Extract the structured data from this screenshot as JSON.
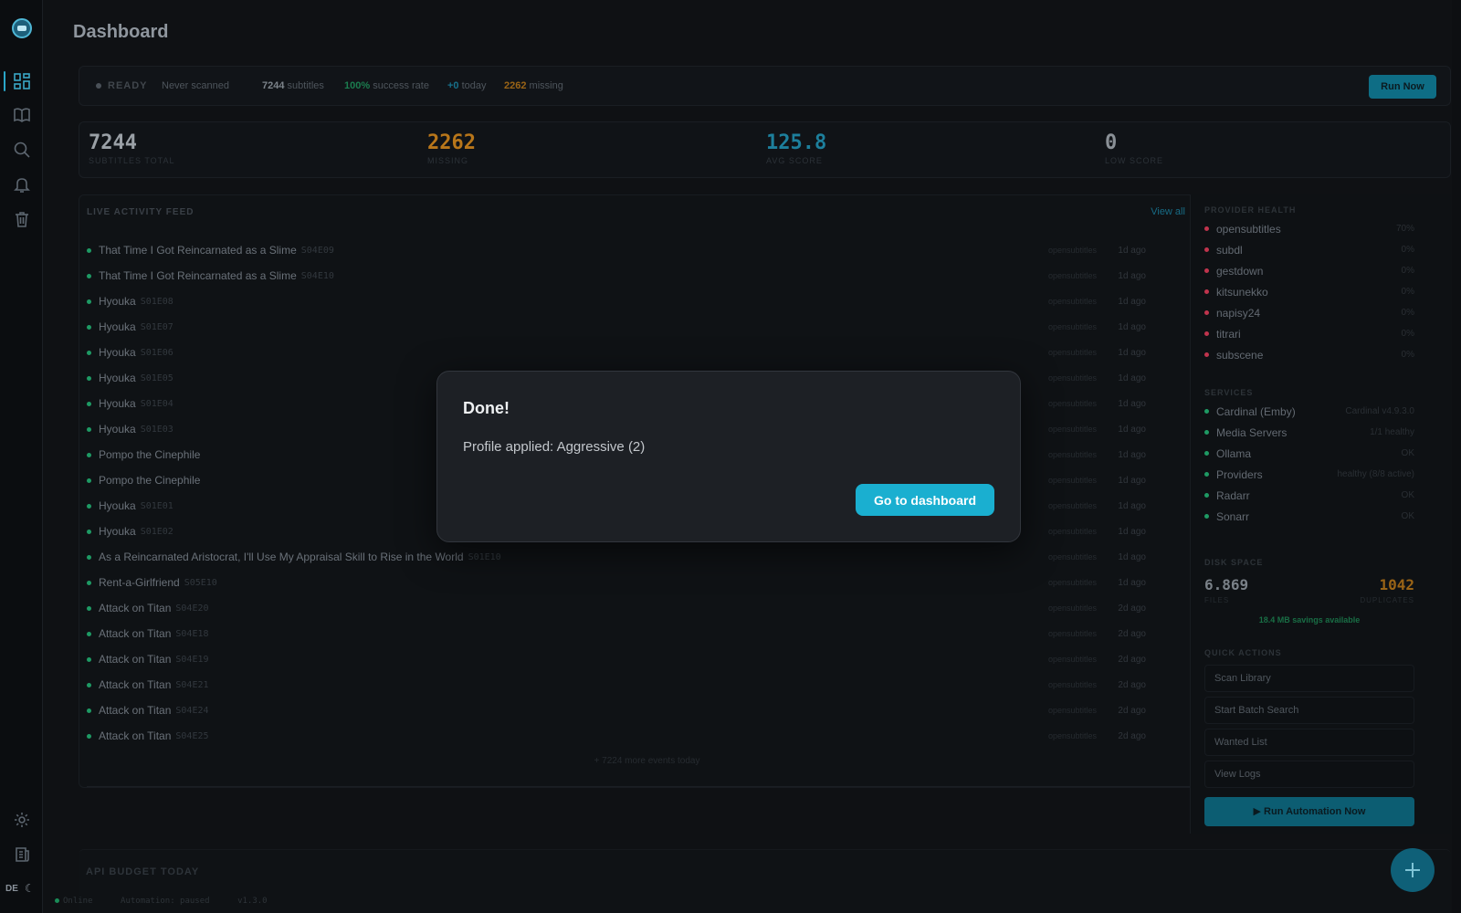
{
  "page": {
    "title": "Dashboard"
  },
  "sidebar": {
    "language": "DE",
    "nav": [
      "dashboard-icon",
      "library-icon",
      "search-icon",
      "bell-icon",
      "trash-icon"
    ],
    "bottom": [
      "gear-icon",
      "logs-icon"
    ]
  },
  "status": {
    "state": "READY",
    "last_scan": "Never scanned",
    "subtitles_count": "7244",
    "subtitles_label": "subtitles",
    "success_rate": "100%",
    "success_label": "success rate",
    "today_count": "+0",
    "today_label": "today",
    "missing_count": "2262",
    "missing_label": "missing",
    "run_now_label": "Run Now"
  },
  "stats": [
    {
      "value": "7244",
      "label": "SUBTITLES TOTAL",
      "color": "#9aa0a6"
    },
    {
      "value": "2262",
      "label": "MISSING",
      "color": "#b8761a"
    },
    {
      "value": "125.8",
      "label": "AVG SCORE",
      "color": "#1d7f9c"
    },
    {
      "value": "0",
      "label": "LOW SCORE",
      "color": "#8a9096"
    }
  ],
  "feed": {
    "title": "LIVE ACTIVITY FEED",
    "view_all": "View all →",
    "more": "+ 7224 more events today",
    "items": [
      {
        "title": "That Time I Got Reincarnated as a Slime",
        "episode": "S04E09",
        "provider": "opensubtitles",
        "time": "1d ago"
      },
      {
        "title": "That Time I Got Reincarnated as a Slime",
        "episode": "S04E10",
        "provider": "opensubtitles",
        "time": "1d ago"
      },
      {
        "title": "Hyouka",
        "episode": "S01E08",
        "provider": "opensubtitles",
        "time": "1d ago"
      },
      {
        "title": "Hyouka",
        "episode": "S01E07",
        "provider": "opensubtitles",
        "time": "1d ago"
      },
      {
        "title": "Hyouka",
        "episode": "S01E06",
        "provider": "opensubtitles",
        "time": "1d ago"
      },
      {
        "title": "Hyouka",
        "episode": "S01E05",
        "provider": "opensubtitles",
        "time": "1d ago"
      },
      {
        "title": "Hyouka",
        "episode": "S01E04",
        "provider": "opensubtitles",
        "time": "1d ago"
      },
      {
        "title": "Hyouka",
        "episode": "S01E03",
        "provider": "opensubtitles",
        "time": "1d ago"
      },
      {
        "title": "Pompo the Cinephile",
        "episode": "",
        "provider": "opensubtitles",
        "time": "1d ago"
      },
      {
        "title": "Pompo the Cinephile",
        "episode": "",
        "provider": "opensubtitles",
        "time": "1d ago"
      },
      {
        "title": "Hyouka",
        "episode": "S01E01",
        "provider": "opensubtitles",
        "time": "1d ago"
      },
      {
        "title": "Hyouka",
        "episode": "S01E02",
        "provider": "opensubtitles",
        "time": "1d ago"
      },
      {
        "title": "As a Reincarnated Aristocrat, I'll Use My Appraisal Skill to Rise in the World",
        "episode": "S01E10",
        "provider": "opensubtitles",
        "time": "1d ago"
      },
      {
        "title": "Rent-a-Girlfriend",
        "episode": "S05E10",
        "provider": "opensubtitles",
        "time": "1d ago"
      },
      {
        "title": "Attack on Titan",
        "episode": "S04E20",
        "provider": "opensubtitles",
        "time": "2d ago"
      },
      {
        "title": "Attack on Titan",
        "episode": "S04E18",
        "provider": "opensubtitles",
        "time": "2d ago"
      },
      {
        "title": "Attack on Titan",
        "episode": "S04E19",
        "provider": "opensubtitles",
        "time": "2d ago"
      },
      {
        "title": "Attack on Titan",
        "episode": "S04E21",
        "provider": "opensubtitles",
        "time": "2d ago"
      },
      {
        "title": "Attack on Titan",
        "episode": "S04E24",
        "provider": "opensubtitles",
        "time": "2d ago"
      },
      {
        "title": "Attack on Titan",
        "episode": "S04E25",
        "provider": "opensubtitles",
        "time": "2d ago"
      }
    ]
  },
  "provider_health": {
    "title": "PROVIDER HEALTH",
    "items": [
      {
        "name": "opensubtitles",
        "value": "70%"
      },
      {
        "name": "subdl",
        "value": "0%"
      },
      {
        "name": "gestdown",
        "value": "0%"
      },
      {
        "name": "kitsunekko",
        "value": "0%"
      },
      {
        "name": "napisy24",
        "value": "0%"
      },
      {
        "name": "titrari",
        "value": "0%"
      },
      {
        "name": "subscene",
        "value": "0%"
      }
    ]
  },
  "services": {
    "title": "SERVICES",
    "items": [
      {
        "name": "Cardinal (Emby)",
        "value": "Cardinal v4.9.3.0"
      },
      {
        "name": "Media Servers",
        "value": "1/1 healthy"
      },
      {
        "name": "Ollama",
        "value": "OK"
      },
      {
        "name": "Providers",
        "value": "healthy (8/8 active)"
      },
      {
        "name": "Radarr",
        "value": "OK"
      },
      {
        "name": "Sonarr",
        "value": "OK"
      }
    ]
  },
  "disk": {
    "title": "DISK SPACE",
    "files_value": "6.869",
    "files_label": "FILES",
    "dup_value": "1042",
    "dup_label": "DUPLICATES",
    "savings": "18.4 MB savings available"
  },
  "quick_actions": {
    "title": "QUICK ACTIONS",
    "items": [
      "Scan Library",
      "Start Batch Search",
      "Wanted List",
      "View Logs"
    ],
    "run_automation": "▶ Run Automation Now"
  },
  "api_budget": {
    "title": "API BUDGET TODAY"
  },
  "footer": {
    "online": "Online",
    "automation": "Automation: paused",
    "version": "v1.3.0"
  },
  "modal": {
    "title": "Done!",
    "message": "Profile applied: Aggressive (2)",
    "button": "Go to dashboard"
  },
  "colors": {
    "accent": "#1aafd0",
    "success": "#1e9a64",
    "warning": "#b8761a",
    "error": "#c0344d"
  }
}
